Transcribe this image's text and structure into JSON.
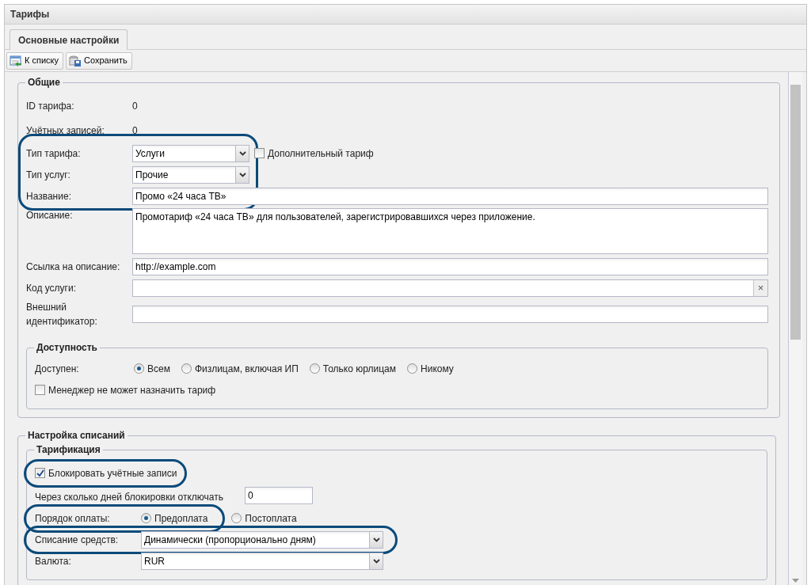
{
  "window": {
    "title": "Тарифы"
  },
  "tabs": [
    {
      "label": "Основные настройки",
      "selected": true
    }
  ],
  "toolbar": [
    {
      "label": "К списку"
    },
    {
      "label": "Сохранить"
    }
  ],
  "general": {
    "title": "Общие",
    "fields": [
      {
        "kind": "static",
        "label": "ID тарифа:",
        "value": "0",
        "highlighted": false
      },
      {
        "kind": "static",
        "label": "Учётных записей:",
        "value": "0",
        "highlighted": false
      },
      {
        "kind": "select",
        "label": "Тип тарифа:",
        "value": "Услуги",
        "highlighted": true,
        "extra": {
          "label": "Дополнительный тариф",
          "checked": false
        }
      },
      {
        "kind": "select",
        "label": "Тип услуг:",
        "value": "Прочие",
        "highlighted": true
      },
      {
        "kind": "text",
        "label": "Название:",
        "value": "Промо «24 часа ТВ»",
        "highlighted": true
      },
      {
        "kind": "textarea",
        "label": "Описание:",
        "value": "Промотариф «24 часа ТВ» для пользователей, зарегистрировавшихся через приложение.",
        "highlighted": false
      },
      {
        "kind": "text",
        "label": "Ссылка на описание:",
        "value": "http://example.com",
        "highlighted": false
      },
      {
        "kind": "clearable",
        "label": "Код услуги:",
        "clear": "×",
        "highlighted": false
      },
      {
        "kind": "text",
        "label": "Внешний идентификатор:",
        "highlighted": false
      }
    ],
    "access": {
      "title": "Доступность",
      "label": "Доступен:",
      "options": [
        {
          "label": "Всем",
          "selected": true
        },
        {
          "label": "Физлицам, включая ИП",
          "selected": false
        },
        {
          "label": "Только юрлицам",
          "selected": false
        },
        {
          "label": "Никому",
          "selected": false
        }
      ],
      "checkbox": {
        "label": "Менеджер не может назначить тариф",
        "checked": false
      }
    }
  },
  "billing": {
    "title": "Настройка списаний",
    "group": {
      "title": "Тарификация",
      "rows": [
        {
          "kind": "checkbox",
          "label": "Блокировать учётные записи",
          "checked": true,
          "highlighted": true
        },
        {
          "kind": "number",
          "label": "Через сколько дней блокировки отключать",
          "value": "0",
          "highlighted": false
        },
        {
          "kind": "radio",
          "label": "Порядок оплаты:",
          "options": [
            {
              "label": "Предоплата",
              "selected": true
            },
            {
              "label": "Постоплата",
              "selected": false
            }
          ],
          "highlighted": true
        },
        {
          "kind": "select",
          "label": "Списание средств:",
          "value": "Динамически (пропорционально дням)",
          "highlighted": true
        },
        {
          "kind": "select",
          "label": "Валюта:",
          "value": "RUR",
          "highlighted": false
        }
      ]
    }
  }
}
